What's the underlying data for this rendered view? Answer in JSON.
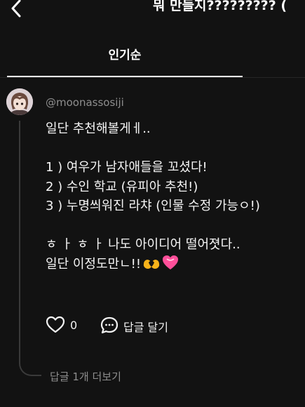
{
  "header": {
    "title": "뭐 만들지????????? ("
  },
  "tabs": [
    {
      "label": "인기순"
    }
  ],
  "comment": {
    "username": "@moonassosiji",
    "lines": [
      "일단 추천해볼게ㅔ..",
      "",
      "1 ) 여우가 남자애들을 꼬셨다!",
      "2 ) 수인 학교 (유피아 추천!)",
      "3 ) 누명씌워진 라챠 (인물 수정 가능ㅇ!)",
      "",
      "ㅎ ㅏ ㅎ ㅏ 나도 아이디어 떨어졋다..",
      "일단 이정도만ㄴ!!"
    ],
    "emojis": [
      "heart-hands",
      "pink-heart"
    ],
    "like_count": "0",
    "reply_label": "답글 달기",
    "more_replies": "답글 1개 더보기"
  },
  "colors": {
    "background": "#121212",
    "text": "#f2f2f2",
    "muted": "#8e8e8e",
    "heart_hands": "#f6b21a",
    "pink_heart": "#ff4f9a"
  },
  "icons": [
    "back-arrow-icon",
    "heart-outline-icon",
    "comment-bubble-icon"
  ]
}
